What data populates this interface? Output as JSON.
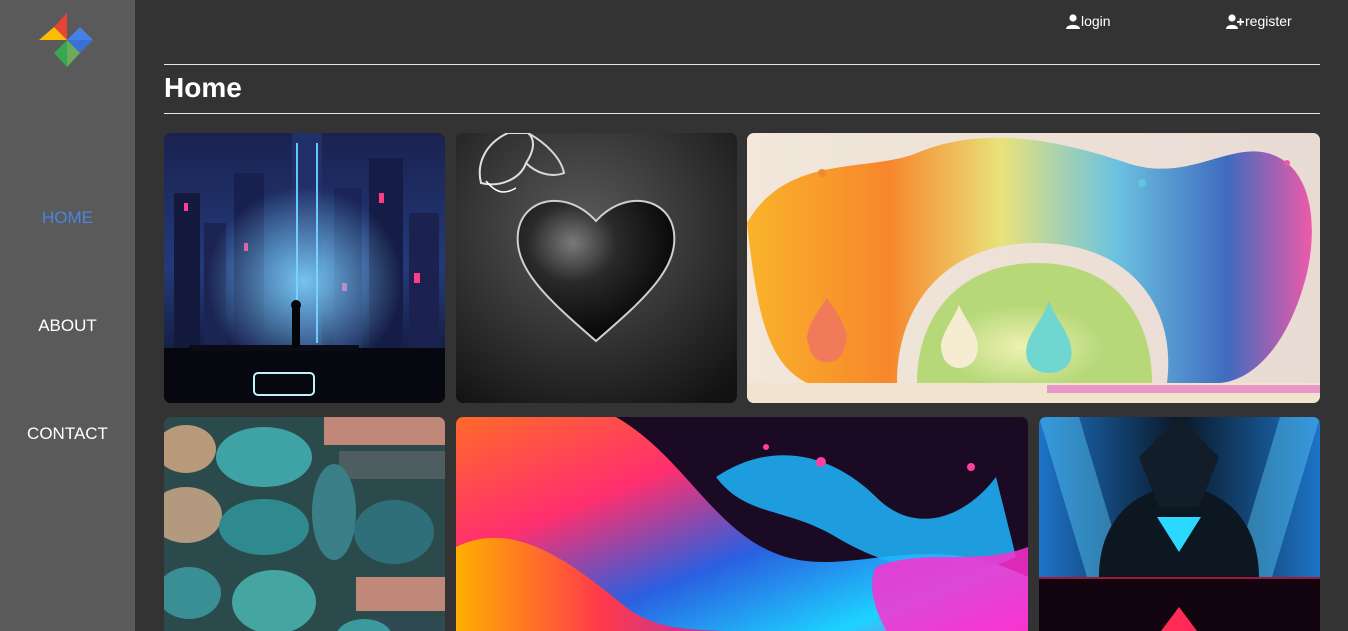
{
  "sidebar": {
    "logo_icon": "pinwheel-logo-icon",
    "items": [
      {
        "label": "HOME",
        "active": true
      },
      {
        "label": "ABOUT",
        "active": false
      },
      {
        "label": "CONTACT",
        "active": false
      }
    ]
  },
  "header": {
    "login": {
      "label": "login",
      "icon": "user-icon"
    },
    "register": {
      "label": "register",
      "icon": "user-plus-icon"
    }
  },
  "page": {
    "title": "Home"
  },
  "gallery": {
    "images": [
      {
        "name": "cyberpunk-city-image"
      },
      {
        "name": "black-heart-butterfly-image"
      },
      {
        "name": "paint-splash-vases-image"
      },
      {
        "name": "teal-stones-image"
      },
      {
        "name": "neon-fluid-swirl-image"
      },
      {
        "name": "hooded-figure-triangle-image"
      }
    ]
  },
  "colors": {
    "background": "#333333",
    "sidebar": "#5a5a5a",
    "active_nav": "#4a86e0",
    "text": "#ffffff"
  }
}
